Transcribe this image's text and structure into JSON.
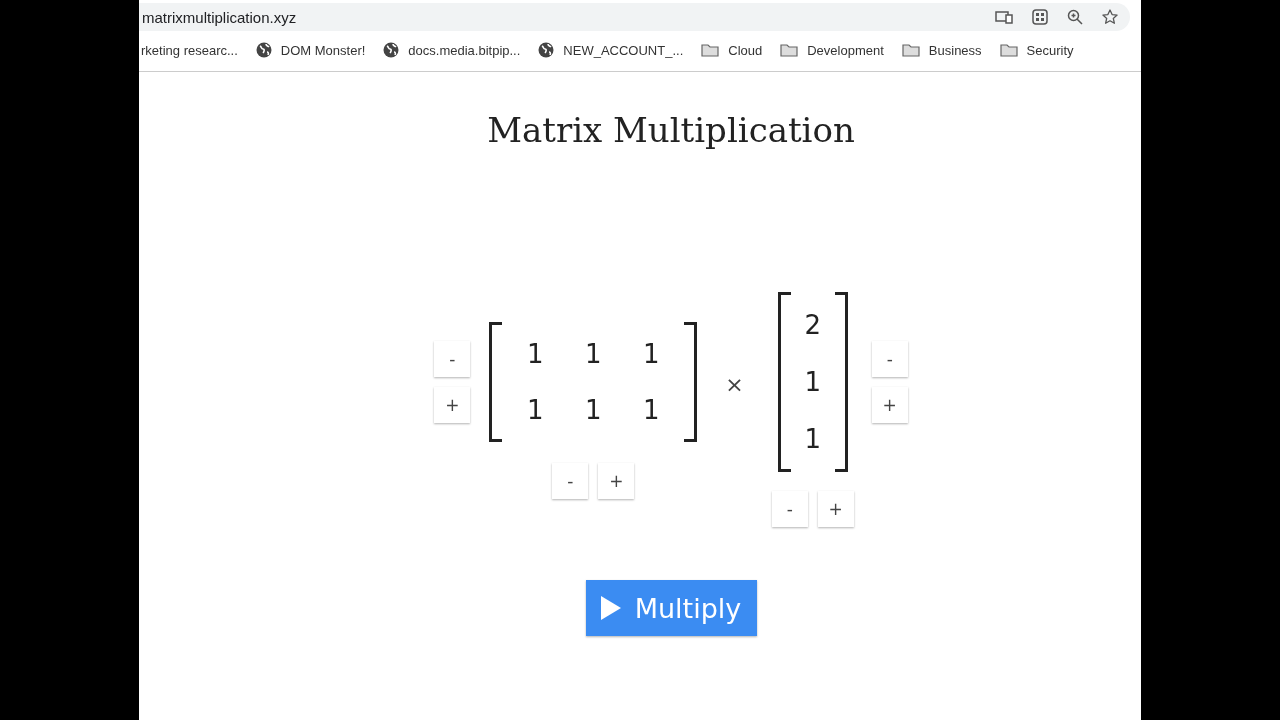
{
  "address_bar": {
    "url": "matrixmultiplication.xyz"
  },
  "bookmarks": [
    {
      "kind": "plain",
      "label": "rketing researc..."
    },
    {
      "kind": "globe",
      "label": "DOM Monster!"
    },
    {
      "kind": "globe",
      "label": "docs.media.bitpip..."
    },
    {
      "kind": "globe",
      "label": "NEW_ACCOUNT_..."
    },
    {
      "kind": "folder",
      "label": "Cloud"
    },
    {
      "kind": "folder",
      "label": "Development"
    },
    {
      "kind": "folder",
      "label": "Business"
    },
    {
      "kind": "folder",
      "label": "Security"
    }
  ],
  "title": "Matrix Multiplication",
  "matrix_a": {
    "rows": [
      [
        "1",
        "1",
        "1"
      ],
      [
        "1",
        "1",
        "1"
      ]
    ],
    "row_buttons": [
      "-",
      "+"
    ],
    "column_buttons": [
      "-",
      "+"
    ]
  },
  "operator": "×",
  "matrix_b": {
    "rows": [
      [
        "2"
      ],
      [
        "1"
      ],
      [
        "1"
      ]
    ],
    "row_buttons": [
      "-",
      "+"
    ],
    "column_buttons": [
      "-",
      "+"
    ]
  },
  "multiply_button": {
    "label": "Multiply"
  }
}
